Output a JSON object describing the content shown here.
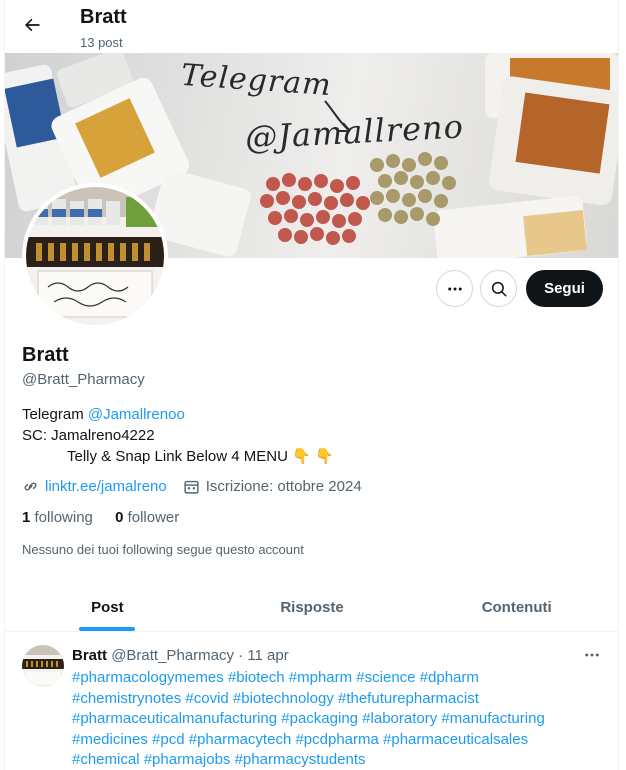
{
  "header": {
    "title": "Bratt",
    "subtitle": "13 post"
  },
  "banner": {
    "line1": "Telegram",
    "line2": "@Jamallreno"
  },
  "profile": {
    "name": "Bratt",
    "handle": "@Bratt_Pharmacy",
    "bio": {
      "line1_prefix": "Telegram ",
      "line1_link": "@Jamallrenoo",
      "line2": "SC: Jamalreno4222",
      "line3": "Telly & Snap Link Below 4 MENU 👇 👇"
    },
    "url": "linktr.ee/jamalreno",
    "joined": "Iscrizione: ottobre 2024",
    "following_count": "1",
    "following_label": "following",
    "followers_count": "0",
    "followers_label": "follower",
    "mutuals_note": "Nessuno dei tuoi following segue questo account"
  },
  "actions": {
    "follow_label": "Segui"
  },
  "tabs": [
    {
      "label": "Post",
      "active": true
    },
    {
      "label": "Risposte",
      "active": false
    },
    {
      "label": "Contenuti",
      "active": false
    }
  ],
  "post": {
    "author": "Bratt",
    "handle": "@Bratt_Pharmacy",
    "separator": "·",
    "date": "11 apr",
    "text_lines": [
      "#pharmacologymemes #biotech #mpharm #science #dpharm",
      "#chemistrynotes #covid #biotechnology #thefuturepharmacist",
      "#pharmaceuticalmanufacturing #packaging #laboratory #manufacturing",
      "#medicines #pcd #pharmacytech #pcdpharma #pharmaceuticalsales",
      "#chemical #pharmajobs #pharmacystudents"
    ]
  },
  "colors": {
    "accent": "#1d9bf0",
    "text": "#0f1419",
    "muted": "#536471",
    "border": "#eff3f4"
  }
}
